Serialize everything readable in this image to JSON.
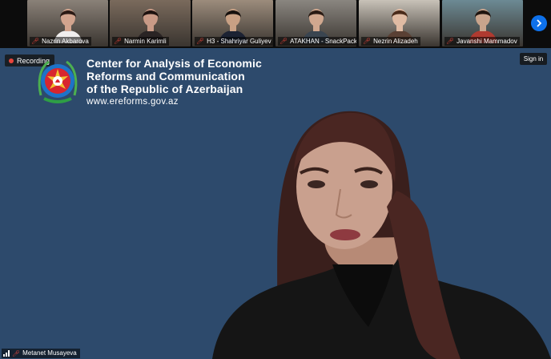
{
  "participants": [
    {
      "name": "Nazrin Akbarova",
      "bg": "#8a8178",
      "skin": "#d2a48e",
      "hair": "#2b1a14",
      "shirt": "#f0eeee"
    },
    {
      "name": "Narmin Karimli",
      "bg": "#7a6a5c",
      "skin": "#c99a86",
      "hair": "#1e120f",
      "shirt": "#2a2424"
    },
    {
      "name": "Shahriyar Guliyev",
      "prefix": "H3 -",
      "bg": "#9c8c7c",
      "skin": "#c8a084",
      "hair": "#17110e",
      "shirt": "#1c2233"
    },
    {
      "name": "ATAKHAN - SnackPack",
      "bg": "#8a8680",
      "skin": "#d1a88f",
      "hair": "#2a1b14",
      "shirt": "#3a4550"
    },
    {
      "name": "Nezrin Alizadeh",
      "bg": "#c8c2b8",
      "skin": "#e0bba3",
      "hair": "#4a2b1a",
      "shirt": "#5a4034"
    },
    {
      "name": "Javanshi Mammadov",
      "bg": "#6c8a94",
      "skin": "#c9a48c",
      "hair": "#20150f",
      "shirt": "#b03a30"
    }
  ],
  "recording_label": "Recording",
  "sign_in_label": "Sign in",
  "org": {
    "line1": "Center for Analysis of Economic",
    "line2": "Reforms and Communication",
    "line3": "of the Republic of Azerbaijan",
    "url": "www.ereforms.gov.az"
  },
  "speaker": {
    "name": "Metanet Musayeva"
  },
  "colors": {
    "stage_bg": "#2d4a6c",
    "accent": "#0e71eb",
    "mute": "#e8453c"
  },
  "icons": {
    "mute": "mic-off-icon",
    "next": "chevron-right-icon",
    "signal": "signal-bars-icon"
  }
}
